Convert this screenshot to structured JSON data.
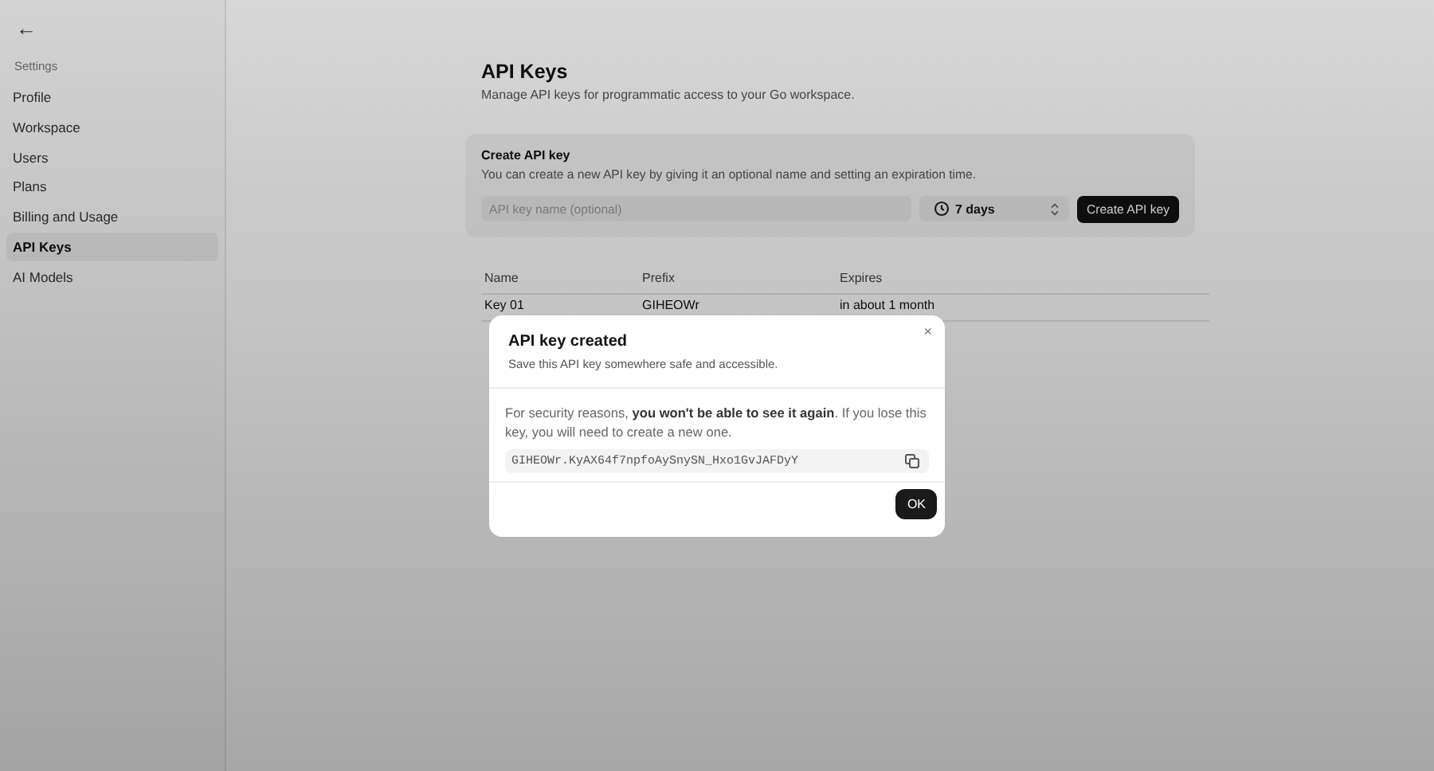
{
  "sidebar": {
    "back": "←",
    "section": "Settings",
    "items": [
      {
        "label": "Profile",
        "selected": false
      },
      {
        "label": "Workspace",
        "selected": false
      },
      {
        "label": "Users",
        "selected": false
      },
      {
        "label": "Plans",
        "selected": false
      },
      {
        "label": "Billing and Usage",
        "selected": false
      },
      {
        "label": "API Keys",
        "selected": true
      },
      {
        "label": "AI Models",
        "selected": false
      }
    ]
  },
  "header": {
    "title": "API Keys",
    "subtitle": "Manage API keys for programmatic access to your Go workspace."
  },
  "create_card": {
    "title": "Create API key",
    "description": "You can create a new API key by giving it an optional name and setting an expiration time.",
    "name_field": {
      "placeholder": "API key name (optional)"
    },
    "expiry": "7 days",
    "button": "Create API key"
  },
  "table": {
    "columns": [
      "Name",
      "Prefix",
      "Expires"
    ],
    "rows": [
      [
        "Key 01",
        "GIHEOWr",
        "in about 1 month"
      ]
    ]
  },
  "dialog": {
    "title": "API key created",
    "subtitle": "Save this API key somewhere safe and accessible.",
    "close": "×",
    "message": "For security reasons, **you won't be able to see it again**. If you lose this key, you will need to create a new one.",
    "key": "GIHEOWr.KyAX64f7npfoAySnySN_Hxo1GvJAFDyY",
    "button": "OK"
  }
}
